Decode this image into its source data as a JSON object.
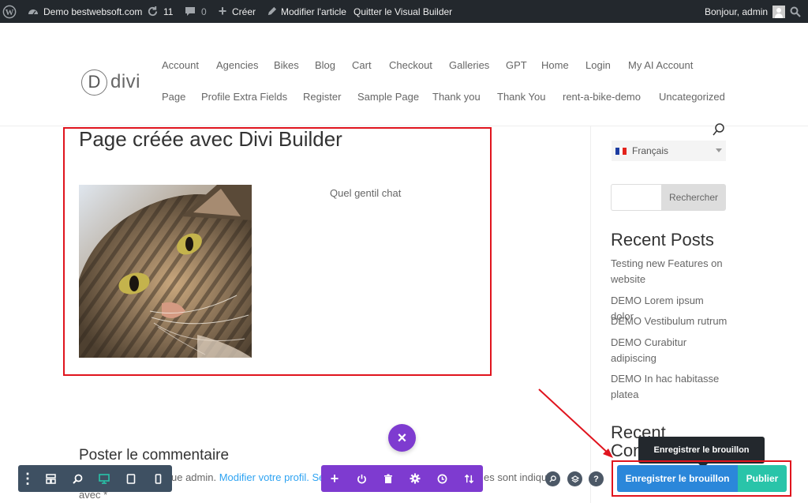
{
  "adminbar": {
    "site_name": "Demo bestwebsoft.com",
    "updates_count": "11",
    "comments_count": "0",
    "create_label": "Créer",
    "edit_label": "Modifier l'article",
    "exit_label": "Quitter le Visual Builder",
    "greeting": "Bonjour, admin"
  },
  "header": {
    "logo_letter": "D",
    "logo_text": "divi",
    "nav_row1": [
      "Account",
      "Agencies",
      "Bikes",
      "Blog",
      "Cart",
      "Checkout",
      "Galleries",
      "GPT",
      "Home",
      "Login",
      "My AI Account"
    ],
    "nav_row2": [
      "Page",
      "Profile Extra Fields",
      "Register",
      "Sample Page",
      "Thank you",
      "Thank You",
      "rent-a-bike-demo",
      "Uncategorized"
    ]
  },
  "main": {
    "title": "Page créée avec Divi Builder",
    "caption": "Quel gentil chat",
    "comment_heading": "Poster le commentaire",
    "comment_prefix": "ue admin.",
    "comment_profile_link": "Modifier votre profil.",
    "comment_se": "Se",
    "comment_suffix": "es sont indiqu",
    "comment_line2": "avec *"
  },
  "sidebar": {
    "language": "Français",
    "search_button": "Rechercher",
    "search_placeholder": "",
    "recent_posts_title": "Recent Posts",
    "recent_posts": [
      "Testing new Features on website",
      "DEMO Lorem ipsum dolor",
      "DEMO Vestibulum rutrum",
      "DEMO Curabitur adipiscing",
      "DEMO In hac habitasse platea"
    ],
    "recent_comments_title": "Recent Comments"
  },
  "builder": {
    "tooltip": "Enregistrer le brouillon",
    "save_draft": "Enregistrer le brouillon",
    "publish": "Publier",
    "close_symbol": "×",
    "help_symbol": "?"
  },
  "colors": {
    "adminbar": "#23282d",
    "annotation_red": "#e0141e",
    "divi_purple": "#7e3bd0",
    "save_blue": "#2b87da",
    "publish_teal": "#29c4a9",
    "left_bar": "#3e5062"
  }
}
